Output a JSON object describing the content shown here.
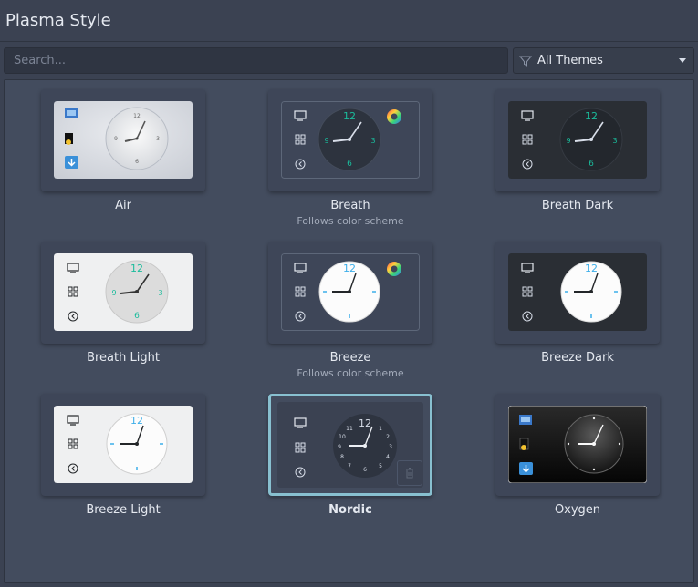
{
  "window": {
    "title": "Plasma Style"
  },
  "search": {
    "placeholder": "Search..."
  },
  "filter": {
    "selected": "All Themes"
  },
  "themes": [
    {
      "name": "Air",
      "subtitle": ""
    },
    {
      "name": "Breath",
      "subtitle": "Follows color scheme"
    },
    {
      "name": "Breath Dark",
      "subtitle": ""
    },
    {
      "name": "Breath Light",
      "subtitle": ""
    },
    {
      "name": "Breeze",
      "subtitle": "Follows color scheme"
    },
    {
      "name": "Breeze Dark",
      "subtitle": ""
    },
    {
      "name": "Breeze Light",
      "subtitle": ""
    },
    {
      "name": "Nordic",
      "subtitle": ""
    },
    {
      "name": "Oxygen",
      "subtitle": ""
    }
  ],
  "selected_theme": "Nordic",
  "colors": {
    "background": "#3b4252",
    "accent": "#88c0d0",
    "grid": "#434c5e"
  },
  "icons": [
    "funnel-icon",
    "chevron-down-icon",
    "monitor-icon",
    "grid-icon",
    "back-icon",
    "color-wheel-icon",
    "trash-icon"
  ]
}
